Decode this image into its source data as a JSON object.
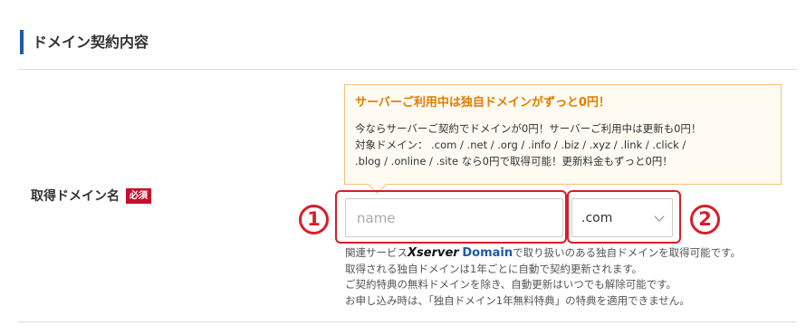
{
  "section": {
    "title": "ドメイン契約内容"
  },
  "row": {
    "label": "取得ドメイン名",
    "required_badge": "必須"
  },
  "notice": {
    "title": "サーバーご利用中は独自ドメインがずっと0円！",
    "lines": [
      "今ならサーバーご契約でドメインが0円！サーバーご利用中は更新も0円！",
      "対象ドメイン： .com / .net / .org / .info / .biz / .xyz / .link / .click /",
      ".blog / .online / .site なら0円で取得可能！更新料金もずっと0円！"
    ]
  },
  "domain_input": {
    "placeholder": "name",
    "value": ""
  },
  "tld_select": {
    "selected": ".com"
  },
  "markers": {
    "one": "1",
    "two": "2"
  },
  "help": {
    "line1_prefix": "関連サービス",
    "brand_x": "Xserver",
    "brand_domain": "Domain",
    "line1_suffix": "で取り扱いのある独自ドメインを取得可能です。",
    "line2": "取得される独自ドメインは1年ごとに自動で契約更新されます。",
    "line3": "ご契約特典の無料ドメインを除き、自動更新はいつでも解除可能です。",
    "line4": "お申し込み時は、「独自ドメイン1年無料特典」の特典を適用できません。"
  },
  "colors": {
    "accent_blue": "#1f5aa6",
    "highlight_red": "#d51f2b",
    "notice_orange": "#e27c00",
    "badge_red": "#c8102e"
  }
}
